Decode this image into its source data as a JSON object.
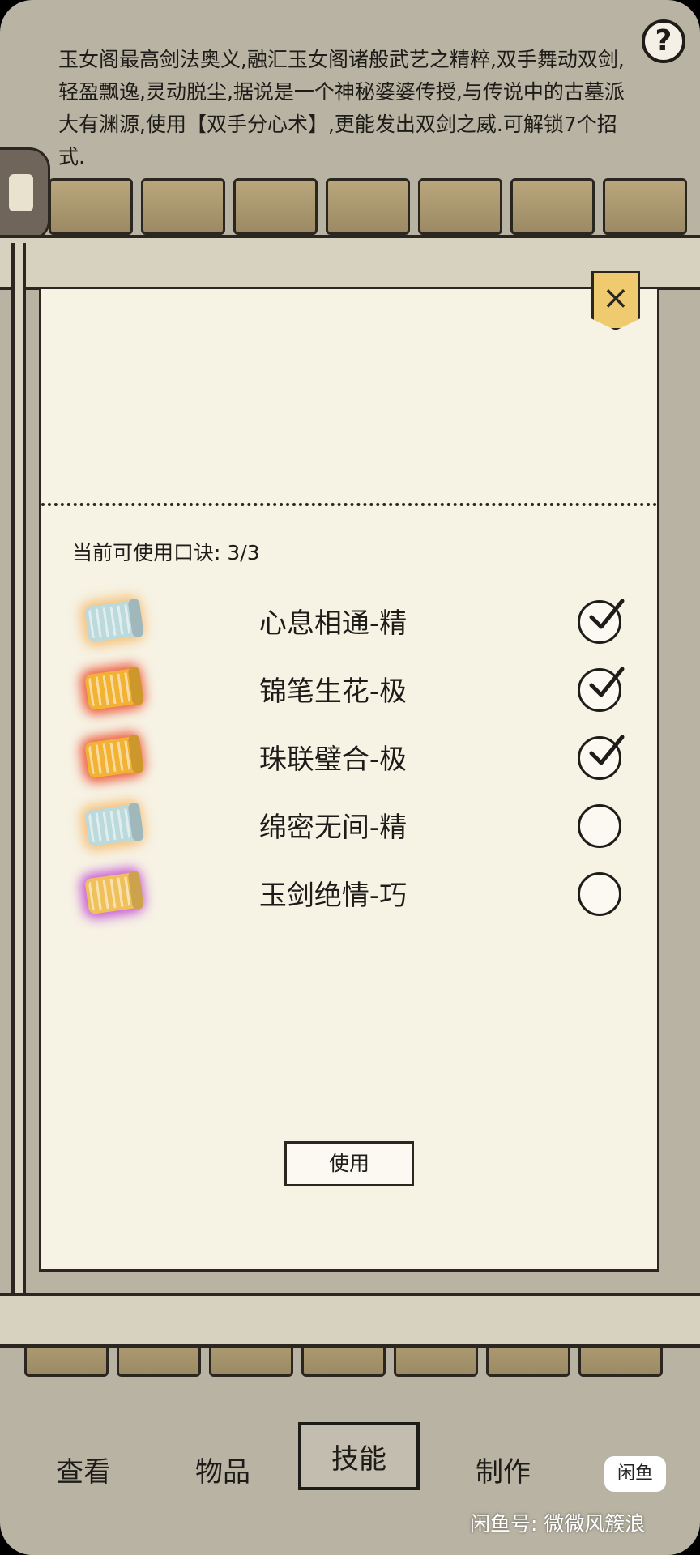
{
  "skill_description": "玉女阁最高剑法奥义,融汇玉女阁诸般武艺之精粹,双手舞动双剑,轻盈飘逸,灵动脱尘,据说是一个神秘婆婆传授,与传说中的古墓派大有渊源,使用【双手分心术】,更能发出双剑之威.可解锁7个招式.",
  "help_icon": "question-mark-icon",
  "modal": {
    "close_icon": "close-x-icon",
    "count_label": "当前可使用口诀: 3/3",
    "mantras": [
      {
        "name": "心息相通-精",
        "icon": "scroll-icon",
        "tier": "jing",
        "selected": true
      },
      {
        "name": "锦笔生花-极",
        "icon": "scroll-icon",
        "tier": "ji",
        "selected": true
      },
      {
        "name": "珠联璧合-极",
        "icon": "scroll-icon",
        "tier": "ji",
        "selected": true
      },
      {
        "name": "绵密无间-精",
        "icon": "scroll-icon",
        "tier": "jing",
        "selected": false
      },
      {
        "name": "玉剑绝情-巧",
        "icon": "scroll-icon",
        "tier": "qiao",
        "selected": false
      }
    ],
    "use_button": "使用"
  },
  "nav": {
    "items": [
      {
        "label": "查看",
        "active": false
      },
      {
        "label": "物品",
        "active": false
      },
      {
        "label": "技能",
        "active": true
      },
      {
        "label": "制作",
        "active": false
      }
    ]
  },
  "watermark": {
    "logo": "闲鱼",
    "text": "闲鱼号: 微微风簇浪"
  },
  "colors": {
    "panel": "#f6f2e4",
    "background": "#b8b3a3",
    "close_button": "#f0ca6e",
    "ink": "#1e1c18"
  }
}
